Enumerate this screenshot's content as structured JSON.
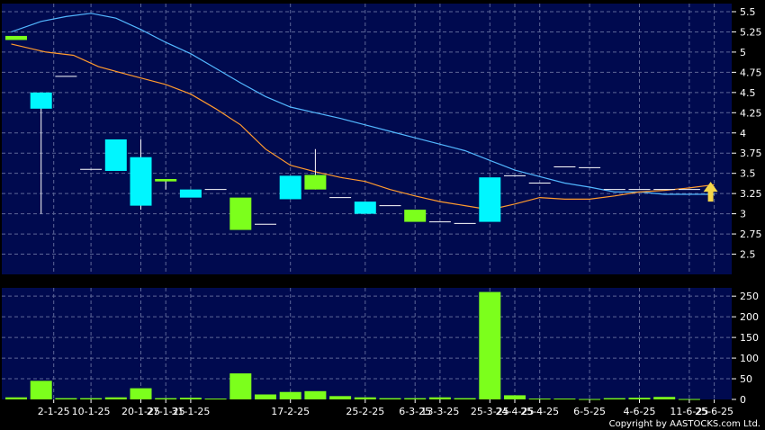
{
  "chart_data": {
    "type": "candlestick",
    "grid": true,
    "colors": {
      "background": "#000000",
      "plot": "#000a4f",
      "grid": "#5d6798",
      "up": "#7cff1c",
      "down": "#00f6ff",
      "volume": "#7cff1c",
      "ma_short": "#ff9b2e",
      "ma_long": "#52b7ff",
      "arrow": "#f5d64a"
    },
    "price_axis": {
      "range": [
        2.25,
        5.6
      ],
      "ticks": [
        "5.5",
        "5.25",
        "5",
        "4.75",
        "4.5",
        "4.25",
        "4",
        "3.75",
        "3.5",
        "3.25",
        "3",
        "2.75",
        "2.5"
      ]
    },
    "volume_axis": {
      "range": [
        0,
        270
      ],
      "ticks": [
        "250",
        "200",
        "150",
        "100",
        "50",
        "0"
      ]
    },
    "x_labels": [
      {
        "label": "2-1-25",
        "idx": 1
      },
      {
        "label": "10-1-25",
        "idx": 3
      },
      {
        "label": "20-1-25",
        "idx": 5
      },
      {
        "label": "27-1-25",
        "idx": 6
      },
      {
        "label": "31-1-25",
        "idx": 7
      },
      {
        "label": "17-2-25",
        "idx": 11
      },
      {
        "label": "25-2-25",
        "idx": 14
      },
      {
        "label": "6-3-25",
        "idx": 16
      },
      {
        "label": "13-3-25",
        "idx": 17
      },
      {
        "label": "25-3-25",
        "idx": 19
      },
      {
        "label": "24-4-25",
        "idx": 20
      },
      {
        "label": "25-4-25",
        "idx": 21
      },
      {
        "label": "6-5-25",
        "idx": 23
      },
      {
        "label": "4-6-25",
        "idx": 25
      },
      {
        "label": "11-6-25",
        "idx": 27
      },
      {
        "label": "25-6-25",
        "idx": 28
      }
    ],
    "candles": [
      {
        "o": 5.15,
        "h": 5.2,
        "l": 5.15,
        "c": 5.2,
        "v": 5
      },
      {
        "o": 4.5,
        "h": 4.5,
        "l": 3.0,
        "c": 4.3,
        "v": 45
      },
      {
        "o": 4.7,
        "h": 4.7,
        "l": 4.7,
        "c": 4.7,
        "v": 3
      },
      {
        "o": 3.55,
        "h": 3.55,
        "l": 3.55,
        "c": 3.55,
        "v": 3
      },
      {
        "o": 3.92,
        "h": 3.92,
        "l": 3.53,
        "c": 3.53,
        "v": 5
      },
      {
        "o": 3.7,
        "h": 3.92,
        "l": 3.05,
        "c": 3.1,
        "v": 27
      },
      {
        "o": 3.4,
        "h": 3.43,
        "l": 3.3,
        "c": 3.43,
        "v": 3
      },
      {
        "o": 3.3,
        "h": 3.3,
        "l": 3.2,
        "c": 3.2,
        "v": 4
      },
      {
        "o": 3.3,
        "h": 3.3,
        "l": 3.3,
        "c": 3.3,
        "v": 2
      },
      {
        "o": 2.8,
        "h": 3.2,
        "l": 2.8,
        "c": 3.2,
        "v": 63
      },
      {
        "o": 2.87,
        "h": 2.87,
        "l": 2.87,
        "c": 2.87,
        "v": 12
      },
      {
        "o": 3.47,
        "h": 3.47,
        "l": 3.18,
        "c": 3.18,
        "v": 18
      },
      {
        "o": 3.3,
        "h": 3.8,
        "l": 3.3,
        "c": 3.48,
        "v": 20
      },
      {
        "o": 3.2,
        "h": 3.2,
        "l": 3.2,
        "c": 3.2,
        "v": 8
      },
      {
        "o": 3.15,
        "h": 3.15,
        "l": 3.0,
        "c": 3.0,
        "v": 5
      },
      {
        "o": 3.1,
        "h": 3.1,
        "l": 3.1,
        "c": 3.1,
        "v": 3
      },
      {
        "o": 2.9,
        "h": 3.05,
        "l": 2.9,
        "c": 3.05,
        "v": 3
      },
      {
        "o": 2.9,
        "h": 2.9,
        "l": 2.9,
        "c": 2.9,
        "v": 5
      },
      {
        "o": 2.88,
        "h": 2.88,
        "l": 2.88,
        "c": 2.88,
        "v": 3
      },
      {
        "o": 3.45,
        "h": 3.45,
        "l": 2.9,
        "c": 2.9,
        "v": 260
      },
      {
        "o": 3.47,
        "h": 3.47,
        "l": 3.47,
        "c": 3.47,
        "v": 10
      },
      {
        "o": 3.38,
        "h": 3.38,
        "l": 3.38,
        "c": 3.38,
        "v": 2
      },
      {
        "o": 3.58,
        "h": 3.58,
        "l": 3.58,
        "c": 3.58,
        "v": 2
      },
      {
        "o": 3.57,
        "h": 3.57,
        "l": 3.57,
        "c": 3.57,
        "v": 1
      },
      {
        "o": 3.3,
        "h": 3.3,
        "l": 3.3,
        "c": 3.3,
        "v": 3
      },
      {
        "o": 3.3,
        "h": 3.3,
        "l": 3.3,
        "c": 3.3,
        "v": 4
      },
      {
        "o": 3.3,
        "h": 3.3,
        "l": 3.3,
        "c": 3.3,
        "v": 6
      },
      {
        "o": 3.3,
        "h": 3.3,
        "l": 3.3,
        "c": 3.3,
        "v": 1
      }
    ],
    "ma_short": [
      [
        -0.2,
        5.1
      ],
      [
        1.2,
        5.0
      ],
      [
        2.3,
        4.96
      ],
      [
        3.3,
        4.82
      ],
      [
        4.5,
        4.72
      ],
      [
        6.0,
        4.6
      ],
      [
        7.0,
        4.48
      ],
      [
        8.0,
        4.3
      ],
      [
        9.0,
        4.1
      ],
      [
        10.0,
        3.8
      ],
      [
        11.0,
        3.6
      ],
      [
        12.0,
        3.52
      ],
      [
        13.0,
        3.45
      ],
      [
        14.0,
        3.4
      ],
      [
        15.0,
        3.3
      ],
      [
        16.0,
        3.22
      ],
      [
        17.0,
        3.15
      ],
      [
        18.0,
        3.1
      ],
      [
        19.0,
        3.05
      ],
      [
        20.0,
        3.12
      ],
      [
        21.0,
        3.2
      ],
      [
        22.0,
        3.18
      ],
      [
        23.0,
        3.18
      ],
      [
        24.0,
        3.22
      ],
      [
        25.0,
        3.27
      ],
      [
        26.0,
        3.29
      ],
      [
        27.0,
        3.32
      ],
      [
        28.0,
        3.36
      ]
    ],
    "ma_long": [
      [
        -0.2,
        5.25
      ],
      [
        1.0,
        5.38
      ],
      [
        2.0,
        5.44
      ],
      [
        3.0,
        5.48
      ],
      [
        4.0,
        5.42
      ],
      [
        5.0,
        5.28
      ],
      [
        6.0,
        5.12
      ],
      [
        7.0,
        4.98
      ],
      [
        8.0,
        4.8
      ],
      [
        9.0,
        4.62
      ],
      [
        10.0,
        4.45
      ],
      [
        11.0,
        4.32
      ],
      [
        12.0,
        4.25
      ],
      [
        13.0,
        4.18
      ],
      [
        14.0,
        4.1
      ],
      [
        15.0,
        4.02
      ],
      [
        16.0,
        3.94
      ],
      [
        17.0,
        3.86
      ],
      [
        18.0,
        3.78
      ],
      [
        19.0,
        3.66
      ],
      [
        20.0,
        3.54
      ],
      [
        21.0,
        3.46
      ],
      [
        22.0,
        3.38
      ],
      [
        23.0,
        3.33
      ],
      [
        24.0,
        3.27
      ],
      [
        25.0,
        3.27
      ],
      [
        26.0,
        3.24
      ],
      [
        27.0,
        3.24
      ],
      [
        28.0,
        3.24
      ]
    ],
    "last_marker": {
      "idx": 28,
      "price": 3.15
    }
  },
  "copyright": "Copyright by AASTOCKS.com Ltd."
}
